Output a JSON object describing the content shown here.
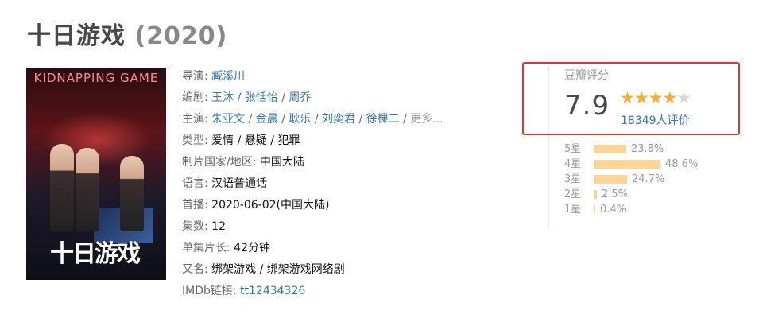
{
  "title": {
    "name": "十日游戏",
    "year": "(2020)"
  },
  "poster": {
    "title_en": "KIDNAPPING GAME",
    "logo": "十日游戏"
  },
  "info": {
    "director": {
      "label": "导演",
      "names": [
        "臧溪川"
      ]
    },
    "writer": {
      "label": "编剧",
      "names": [
        "王沐",
        "张恬怡",
        "周乔"
      ]
    },
    "cast": {
      "label": "主演",
      "names": [
        "朱亚文",
        "金晨",
        "耿乐",
        "刘奕君",
        "徐棵二"
      ],
      "more": "更多..."
    },
    "genre": {
      "label": "类型",
      "value": "爱情 / 悬疑 / 犯罪"
    },
    "region": {
      "label": "制片国家/地区",
      "value": "中国大陆"
    },
    "language": {
      "label": "语言",
      "value": "汉语普通话"
    },
    "premiere": {
      "label": "首播",
      "value": "2020-06-02(中国大陆)"
    },
    "episodes": {
      "label": "集数",
      "value": "12"
    },
    "runtime": {
      "label": "单集片长",
      "value": "42分钟"
    },
    "aka": {
      "label": "又名",
      "value": "绑架游戏 / 绑架游戏网络剧"
    },
    "imdb": {
      "label": "IMDb链接",
      "value": "tt12434326"
    }
  },
  "rating": {
    "label": "豆瓣评分",
    "score": "7.9",
    "stars": 4,
    "votes_text": "18349人评价",
    "distribution": [
      {
        "label": "5星",
        "percent_text": "23.8%",
        "percent": 23.8
      },
      {
        "label": "4星",
        "percent_text": "48.6%",
        "percent": 48.6
      },
      {
        "label": "3星",
        "percent_text": "24.7%",
        "percent": 24.7
      },
      {
        "label": "2星",
        "percent_text": "2.5%",
        "percent": 2.5
      },
      {
        "label": "1星",
        "percent_text": "0.4%",
        "percent": 0.4
      }
    ]
  },
  "colors": {
    "link": "#3377aa",
    "star": "#ffac2d",
    "bar": "#ffd596",
    "highlight_border": "#e8302e"
  }
}
